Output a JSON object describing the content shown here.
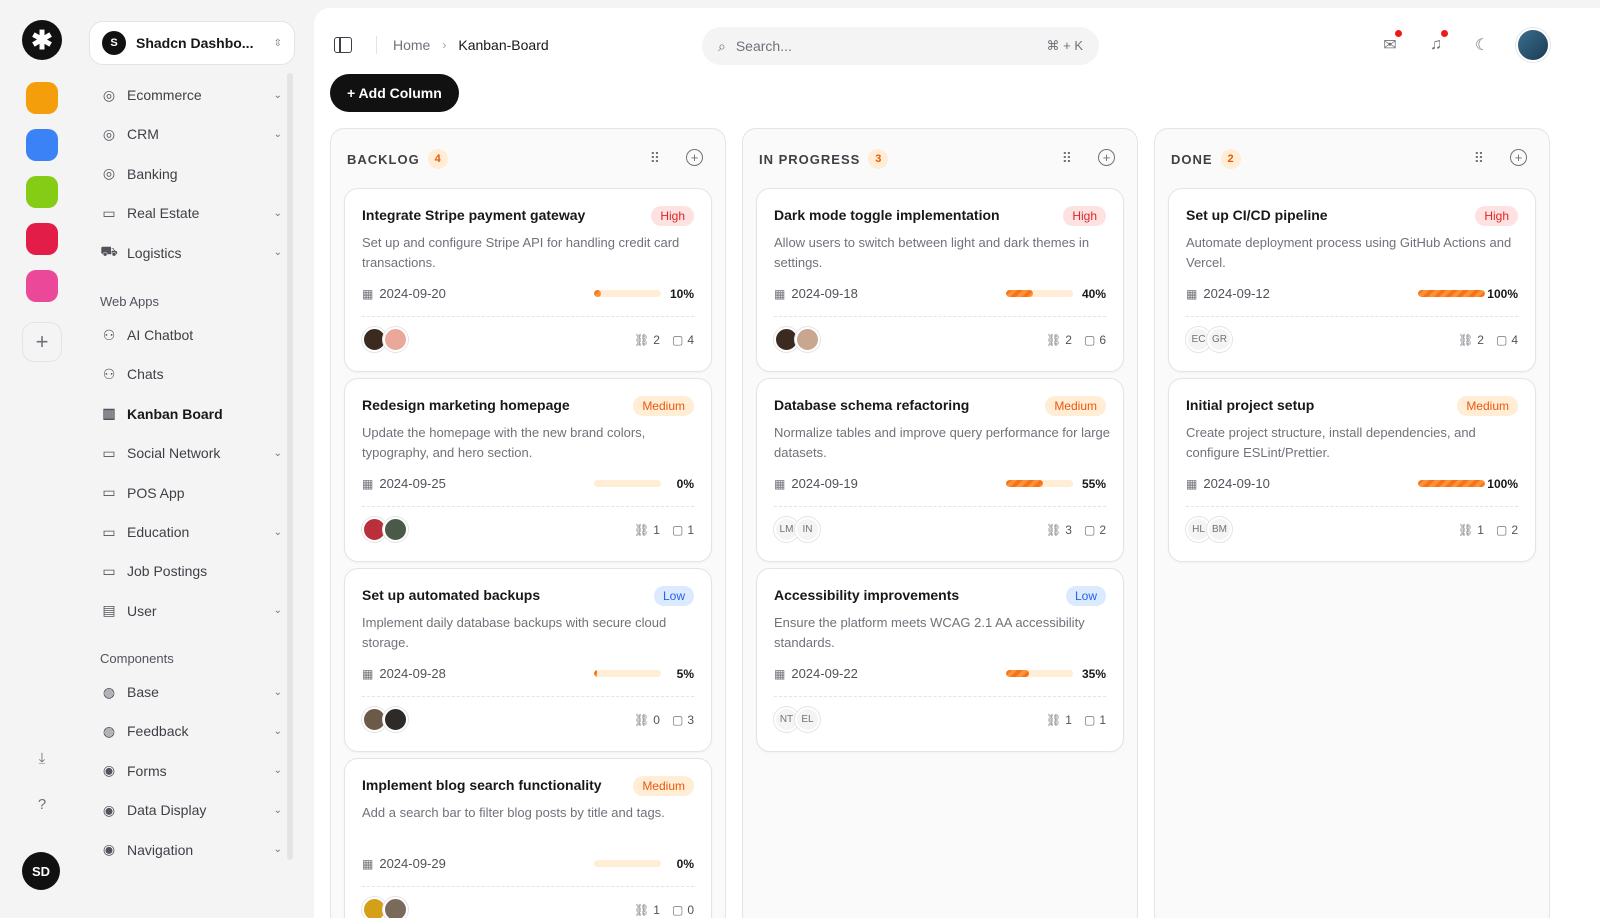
{
  "workspace": {
    "initial": "S",
    "name": "Shadcn Dashbo..."
  },
  "rail": {
    "logo": "✱",
    "user_initials": "SD",
    "apps": [
      {
        "name": "notes-app-icon",
        "color": "#f59e0b"
      },
      {
        "name": "phone-app-icon",
        "color": "#3b82f6"
      },
      {
        "name": "owl-app-icon",
        "color": "#84cc16"
      },
      {
        "name": "cube-app-icon",
        "color": "#e11d48"
      },
      {
        "name": "slack-app-icon",
        "color": "#ec4899"
      }
    ]
  },
  "sidebar": {
    "items1": [
      {
        "label": "Ecommerce",
        "icon": "◎",
        "chev": true
      },
      {
        "label": "CRM",
        "icon": "◎",
        "chev": true
      },
      {
        "label": "Banking",
        "icon": "◎",
        "chev": false
      },
      {
        "label": "Real Estate",
        "icon": "▭",
        "chev": true
      },
      {
        "label": "Logistics",
        "icon": "⛟",
        "chev": true
      }
    ],
    "section_web": "Web Apps",
    "items2": [
      {
        "label": "AI Chatbot",
        "icon": "⚇",
        "chev": false
      },
      {
        "label": "Chats",
        "icon": "⚇",
        "chev": false
      },
      {
        "label": "Kanban Board",
        "icon": "▥",
        "chev": false,
        "active": true
      },
      {
        "label": "Social Network",
        "icon": "▭",
        "chev": true
      },
      {
        "label": "POS App",
        "icon": "▭",
        "chev": false
      },
      {
        "label": "Education",
        "icon": "▭",
        "chev": true
      },
      {
        "label": "Job Postings",
        "icon": "▭",
        "chev": false
      },
      {
        "label": "User",
        "icon": "▤",
        "chev": true
      }
    ],
    "section_components": "Components",
    "items3": [
      {
        "label": "Base",
        "icon": "◍",
        "chev": true
      },
      {
        "label": "Feedback",
        "icon": "◍",
        "chev": true
      },
      {
        "label": "Forms",
        "icon": "◉",
        "chev": true
      },
      {
        "label": "Data Display",
        "icon": "◉",
        "chev": true
      },
      {
        "label": "Navigation",
        "icon": "◉",
        "chev": true
      }
    ]
  },
  "header": {
    "home": "Home",
    "current": "Kanban-Board",
    "search_placeholder": "Search...",
    "shortcut": "⌘ + K"
  },
  "add_column": "+ Add Column",
  "columns": [
    {
      "title": "BACKLOG",
      "count": "4",
      "cards": [
        {
          "title": "Integrate Stripe payment gateway",
          "priority": "High",
          "desc": "Set up and configure Stripe API for handling credit card transactions.",
          "date": "2024-09-20",
          "progress": 10,
          "pct": "10%",
          "avatars": [
            {
              "t": "",
              "c": "#3b2a20"
            },
            {
              "t": "",
              "c": "#e9a89a"
            }
          ],
          "links": "2",
          "comments": "4"
        },
        {
          "title": "Redesign marketing homepage",
          "priority": "Medium",
          "desc": "Update the homepage with the new brand colors, typography, and hero section.",
          "date": "2024-09-25",
          "progress": 0,
          "pct": "0%",
          "avatars": [
            {
              "t": "",
              "c": "#b9303a"
            },
            {
              "t": "",
              "c": "#4a5a48"
            }
          ],
          "links": "1",
          "comments": "1"
        },
        {
          "title": "Set up automated backups",
          "priority": "Low",
          "desc": "Implement daily database backups with secure cloud storage.",
          "date": "2024-09-28",
          "progress": 5,
          "pct": "5%",
          "avatars": [
            {
              "t": "",
              "c": "#6b5a48"
            },
            {
              "t": "",
              "c": "#2e2a28"
            }
          ],
          "links": "0",
          "comments": "3"
        },
        {
          "title": "Implement blog search functionality",
          "priority": "Medium",
          "desc": "Add a search bar to filter blog posts by title and tags.",
          "date": "2024-09-29",
          "progress": 0,
          "pct": "0%",
          "avatars": [
            {
              "t": "",
              "c": "#d4a017"
            },
            {
              "t": "",
              "c": "#7a6a5a"
            }
          ],
          "links": "1",
          "comments": "0"
        }
      ]
    },
    {
      "title": "IN PROGRESS",
      "count": "3",
      "cards": [
        {
          "title": "Dark mode toggle implementation",
          "priority": "High",
          "desc": "Allow users to switch between light and dark themes in settings.",
          "date": "2024-09-18",
          "progress": 40,
          "pct": "40%",
          "avatars": [
            {
              "t": "",
              "c": "#3b2a20"
            },
            {
              "t": "",
              "c": "#c9a78e"
            }
          ],
          "links": "2",
          "comments": "6"
        },
        {
          "title": "Database schema refactoring",
          "priority": "Medium",
          "desc": "Normalize tables and improve query performance for large datasets.",
          "date": "2024-09-19",
          "progress": 55,
          "pct": "55%",
          "avatars": [
            {
              "t": "LM",
              "c": ""
            },
            {
              "t": "IN",
              "c": ""
            }
          ],
          "links": "3",
          "comments": "2"
        },
        {
          "title": "Accessibility improvements",
          "priority": "Low",
          "desc": "Ensure the platform meets WCAG 2.1 AA accessibility standards.",
          "date": "2024-09-22",
          "progress": 35,
          "pct": "35%",
          "avatars": [
            {
              "t": "NT",
              "c": ""
            },
            {
              "t": "EL",
              "c": ""
            }
          ],
          "links": "1",
          "comments": "1"
        }
      ]
    },
    {
      "title": "DONE",
      "count": "2",
      "cards": [
        {
          "title": "Set up CI/CD pipeline",
          "priority": "High",
          "desc": "Automate deployment process using GitHub Actions and Vercel.",
          "date": "2024-09-12",
          "progress": 100,
          "pct": "100%",
          "avatars": [
            {
              "t": "EC",
              "c": ""
            },
            {
              "t": "GR",
              "c": ""
            }
          ],
          "links": "2",
          "comments": "4"
        },
        {
          "title": "Initial project setup",
          "priority": "Medium",
          "desc": "Create project structure, install dependencies, and configure ESLint/Prettier.",
          "date": "2024-09-10",
          "progress": 100,
          "pct": "100%",
          "avatars": [
            {
              "t": "HL",
              "c": ""
            },
            {
              "t": "BM",
              "c": ""
            }
          ],
          "links": "1",
          "comments": "2"
        }
      ]
    }
  ]
}
